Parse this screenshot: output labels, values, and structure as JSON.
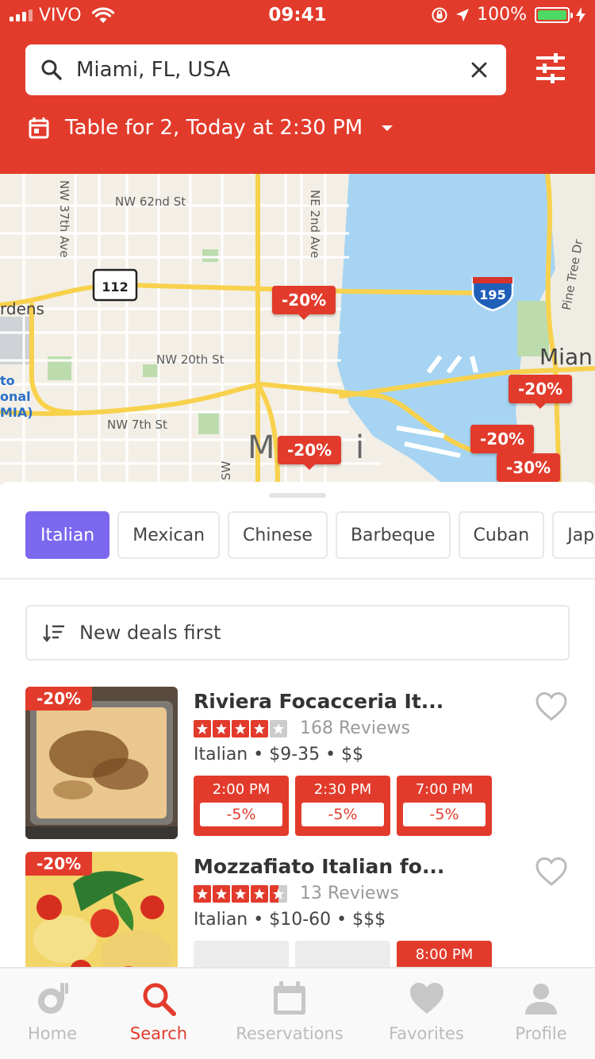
{
  "status_bar": {
    "carrier": "VIVO",
    "time": "09:41",
    "battery": "100%"
  },
  "search": {
    "value": "Miami, FL, USA"
  },
  "reservation": {
    "label": "Table for 2, Today at 2:30 PM"
  },
  "map": {
    "labels": [
      "NW 62nd St",
      "NW 37th Ave",
      "NE 2nd Ave",
      "NW 20th St",
      "NW 7th St",
      "Pine Tree Dr",
      "rdens",
      "Mian",
      "to",
      "onal",
      "MIA)",
      "SW",
      "M",
      "i",
      "112",
      "195"
    ],
    "pins": [
      "-20%",
      "-20%",
      "-20%",
      "-20%",
      "-30%"
    ]
  },
  "categories": [
    "Italian",
    "Mexican",
    "Chinese",
    "Barbeque",
    "Cuban",
    "Jap"
  ],
  "active_category": "Italian",
  "sort": {
    "label": "New deals first"
  },
  "restaurants": [
    {
      "name": "Riviera Focacceria It...",
      "discount": "-20%",
      "rating": 4,
      "reviews": "168 Reviews",
      "cuisine": "Italian",
      "price_range": "$9-35",
      "price_level": "$$",
      "slots": [
        {
          "time": "2:00 PM",
          "deal": "-5%"
        },
        {
          "time": "2:30 PM",
          "deal": "-5%"
        },
        {
          "time": "7:00 PM",
          "deal": "-5%"
        }
      ]
    },
    {
      "name": "Mozzafiato Italian fo...",
      "discount": "-20%",
      "rating": 4.5,
      "reviews": "13 Reviews",
      "cuisine": "Italian",
      "price_range": "$10-60",
      "price_level": "$$$",
      "slots": [
        {
          "time": ""
        },
        {
          "time": ""
        },
        {
          "time": "8:00 PM"
        }
      ]
    }
  ],
  "tabs": [
    "Home",
    "Search",
    "Reservations",
    "Favorites",
    "Profile"
  ],
  "active_tab": "Search",
  "colors": {
    "brand": "#e23b2c",
    "chip_active": "#7b68ee",
    "star_empty": "#cccccc",
    "battery": "#4cd964"
  }
}
